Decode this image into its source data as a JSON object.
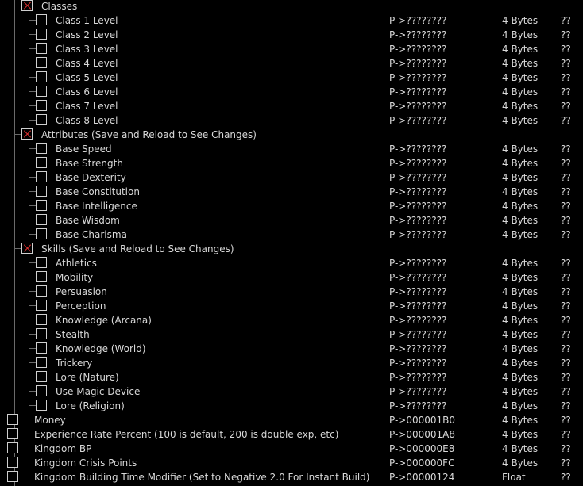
{
  "rows": [
    {
      "desc": "Classes",
      "addr": "",
      "type": "",
      "val": "",
      "checked": true,
      "level": 1
    },
    {
      "desc": "Class 1 Level",
      "addr": "P->????????",
      "type": "4 Bytes",
      "val": "??",
      "checked": false,
      "level": 2
    },
    {
      "desc": "Class 2 Level",
      "addr": "P->????????",
      "type": "4 Bytes",
      "val": "??",
      "checked": false,
      "level": 2
    },
    {
      "desc": "Class 3 Level",
      "addr": "P->????????",
      "type": "4 Bytes",
      "val": "??",
      "checked": false,
      "level": 2
    },
    {
      "desc": "Class 4 Level",
      "addr": "P->????????",
      "type": "4 Bytes",
      "val": "??",
      "checked": false,
      "level": 2
    },
    {
      "desc": "Class 5 Level",
      "addr": "P->????????",
      "type": "4 Bytes",
      "val": "??",
      "checked": false,
      "level": 2
    },
    {
      "desc": "Class 6 Level",
      "addr": "P->????????",
      "type": "4 Bytes",
      "val": "??",
      "checked": false,
      "level": 2
    },
    {
      "desc": "Class 7 Level",
      "addr": "P->????????",
      "type": "4 Bytes",
      "val": "??",
      "checked": false,
      "level": 2
    },
    {
      "desc": "Class 8 Level",
      "addr": "P->????????",
      "type": "4 Bytes",
      "val": "??",
      "checked": false,
      "level": 2
    },
    {
      "desc": "Attributes (Save and Reload to See Changes)",
      "addr": "",
      "type": "",
      "val": "",
      "checked": true,
      "level": 1
    },
    {
      "desc": "Base Speed",
      "addr": "P->????????",
      "type": "4 Bytes",
      "val": "??",
      "checked": false,
      "level": 2
    },
    {
      "desc": "Base Strength",
      "addr": "P->????????",
      "type": "4 Bytes",
      "val": "??",
      "checked": false,
      "level": 2
    },
    {
      "desc": "Base Dexterity",
      "addr": "P->????????",
      "type": "4 Bytes",
      "val": "??",
      "checked": false,
      "level": 2
    },
    {
      "desc": "Base Constitution",
      "addr": "P->????????",
      "type": "4 Bytes",
      "val": "??",
      "checked": false,
      "level": 2
    },
    {
      "desc": "Base Intelligence",
      "addr": "P->????????",
      "type": "4 Bytes",
      "val": "??",
      "checked": false,
      "level": 2
    },
    {
      "desc": "Base Wisdom",
      "addr": "P->????????",
      "type": "4 Bytes",
      "val": "??",
      "checked": false,
      "level": 2
    },
    {
      "desc": "Base Charisma",
      "addr": "P->????????",
      "type": "4 Bytes",
      "val": "??",
      "checked": false,
      "level": 2
    },
    {
      "desc": "Skills (Save and Reload to See Changes)",
      "addr": "",
      "type": "",
      "val": "",
      "checked": true,
      "level": 1
    },
    {
      "desc": "Athletics",
      "addr": "P->????????",
      "type": "4 Bytes",
      "val": "??",
      "checked": false,
      "level": 2
    },
    {
      "desc": "Mobility",
      "addr": "P->????????",
      "type": "4 Bytes",
      "val": "??",
      "checked": false,
      "level": 2
    },
    {
      "desc": "Persuasion",
      "addr": "P->????????",
      "type": "4 Bytes",
      "val": "??",
      "checked": false,
      "level": 2
    },
    {
      "desc": "Perception",
      "addr": "P->????????",
      "type": "4 Bytes",
      "val": "??",
      "checked": false,
      "level": 2
    },
    {
      "desc": "Knowledge (Arcana)",
      "addr": "P->????????",
      "type": "4 Bytes",
      "val": "??",
      "checked": false,
      "level": 2
    },
    {
      "desc": "Stealth",
      "addr": "P->????????",
      "type": "4 Bytes",
      "val": "??",
      "checked": false,
      "level": 2
    },
    {
      "desc": "Knowledge (World)",
      "addr": "P->????????",
      "type": "4 Bytes",
      "val": "??",
      "checked": false,
      "level": 2
    },
    {
      "desc": "Trickery",
      "addr": "P->????????",
      "type": "4 Bytes",
      "val": "??",
      "checked": false,
      "level": 2
    },
    {
      "desc": "Lore (Nature)",
      "addr": "P->????????",
      "type": "4 Bytes",
      "val": "??",
      "checked": false,
      "level": 2
    },
    {
      "desc": "Use Magic Device",
      "addr": "P->????????",
      "type": "4 Bytes",
      "val": "??",
      "checked": false,
      "level": 2
    },
    {
      "desc": "Lore (Religion)",
      "addr": "P->????????",
      "type": "4 Bytes",
      "val": "??",
      "checked": false,
      "level": 2
    },
    {
      "desc": "Money",
      "addr": "P->000001B0",
      "type": "4 Bytes",
      "val": "??",
      "checked": false,
      "level": 0
    },
    {
      "desc": "Experience Rate Percent (100 is default, 200 is double exp, etc)",
      "addr": "P->000001A8",
      "type": "4 Bytes",
      "val": "??",
      "checked": false,
      "level": 0
    },
    {
      "desc": "Kingdom BP",
      "addr": "P->000000E8",
      "type": "4 Bytes",
      "val": "??",
      "checked": false,
      "level": 0
    },
    {
      "desc": "Kingdom Crisis Points",
      "addr": "P->000000FC",
      "type": "4 Bytes",
      "val": "??",
      "checked": false,
      "level": 0
    },
    {
      "desc": "Kingdom Building Time Modifier (Set to Negative 2.0 For Instant Build)",
      "addr": "P->00000124",
      "type": "Float",
      "val": "??",
      "checked": false,
      "level": 0
    }
  ]
}
